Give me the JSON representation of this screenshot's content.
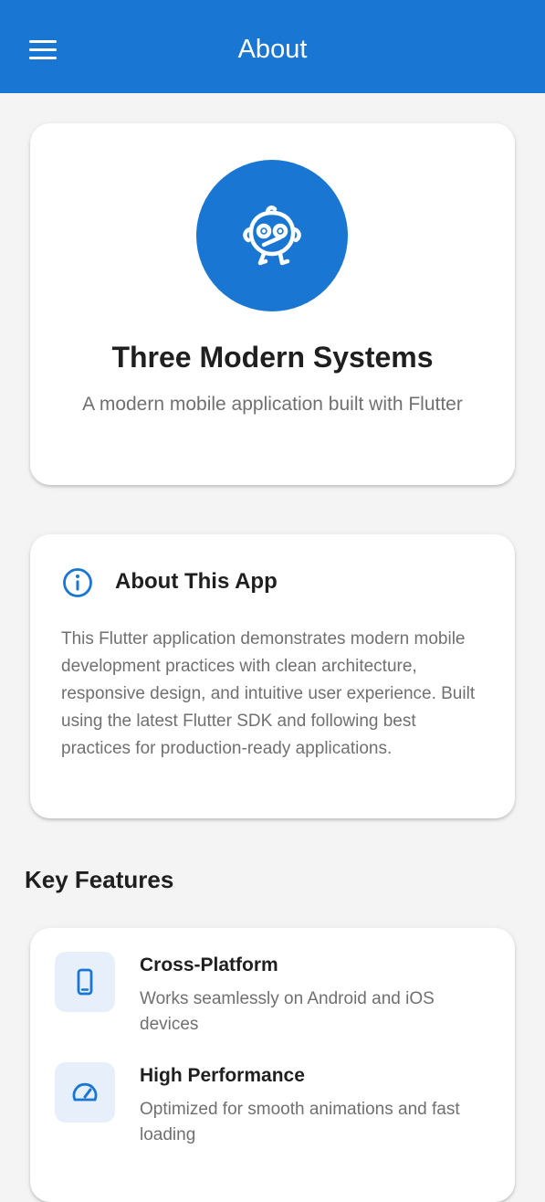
{
  "app_bar": {
    "title": "About",
    "menu_icon": "hamburger-menu-icon",
    "color": "#1976d2"
  },
  "hero": {
    "logo_icon": "bird-mascot-icon",
    "title": "Three Modern Systems",
    "subtitle": "A modern mobile application built with Flutter"
  },
  "about": {
    "icon": "info-icon",
    "heading": "About This App",
    "body": "This Flutter application demonstrates modern mobile development practices with clean architecture, responsive design, and intuitive user experience. Built using the latest Flutter SDK and following best practices for production-ready applications."
  },
  "features": {
    "heading": "Key Features",
    "items": [
      {
        "icon": "smartphone-icon",
        "title": "Cross-Platform",
        "description": "Works seamlessly on Android and iOS devices"
      },
      {
        "icon": "speedometer-icon",
        "title": "High Performance",
        "description": "Optimized for smooth animations and fast loading"
      }
    ]
  },
  "colors": {
    "primary": "#1976d2",
    "background": "#f4f4f4",
    "card": "#ffffff",
    "icon_tile": "#e6effa"
  }
}
